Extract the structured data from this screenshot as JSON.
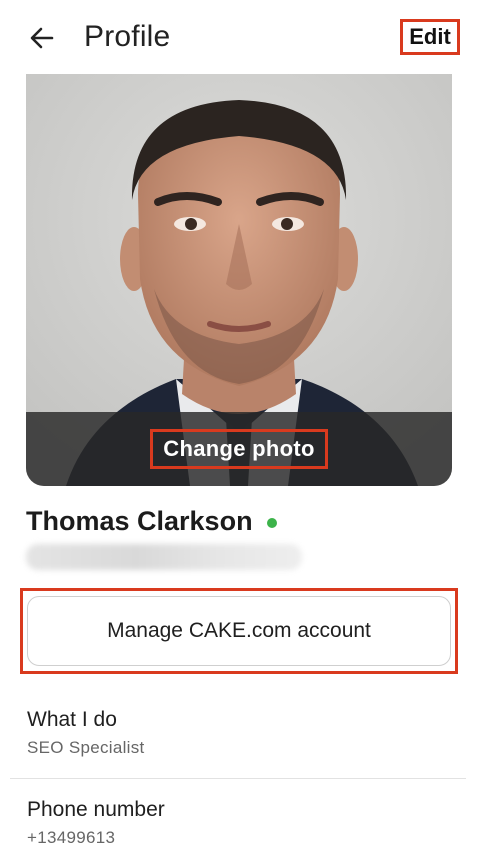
{
  "header": {
    "title": "Profile",
    "back_icon": "arrow-left-icon",
    "edit_label": "Edit"
  },
  "photo": {
    "change_photo_label": "Change photo"
  },
  "profile": {
    "name": "Thomas Clarkson",
    "status": "online",
    "status_color": "#3cb34a"
  },
  "manage_account": {
    "label": "Manage CAKE.com account"
  },
  "fields": [
    {
      "label": "What I do",
      "value": "SEO Specialist"
    },
    {
      "label": "Phone number",
      "value": "+13499613"
    }
  ],
  "colors": {
    "highlight": "#d93a1e"
  }
}
